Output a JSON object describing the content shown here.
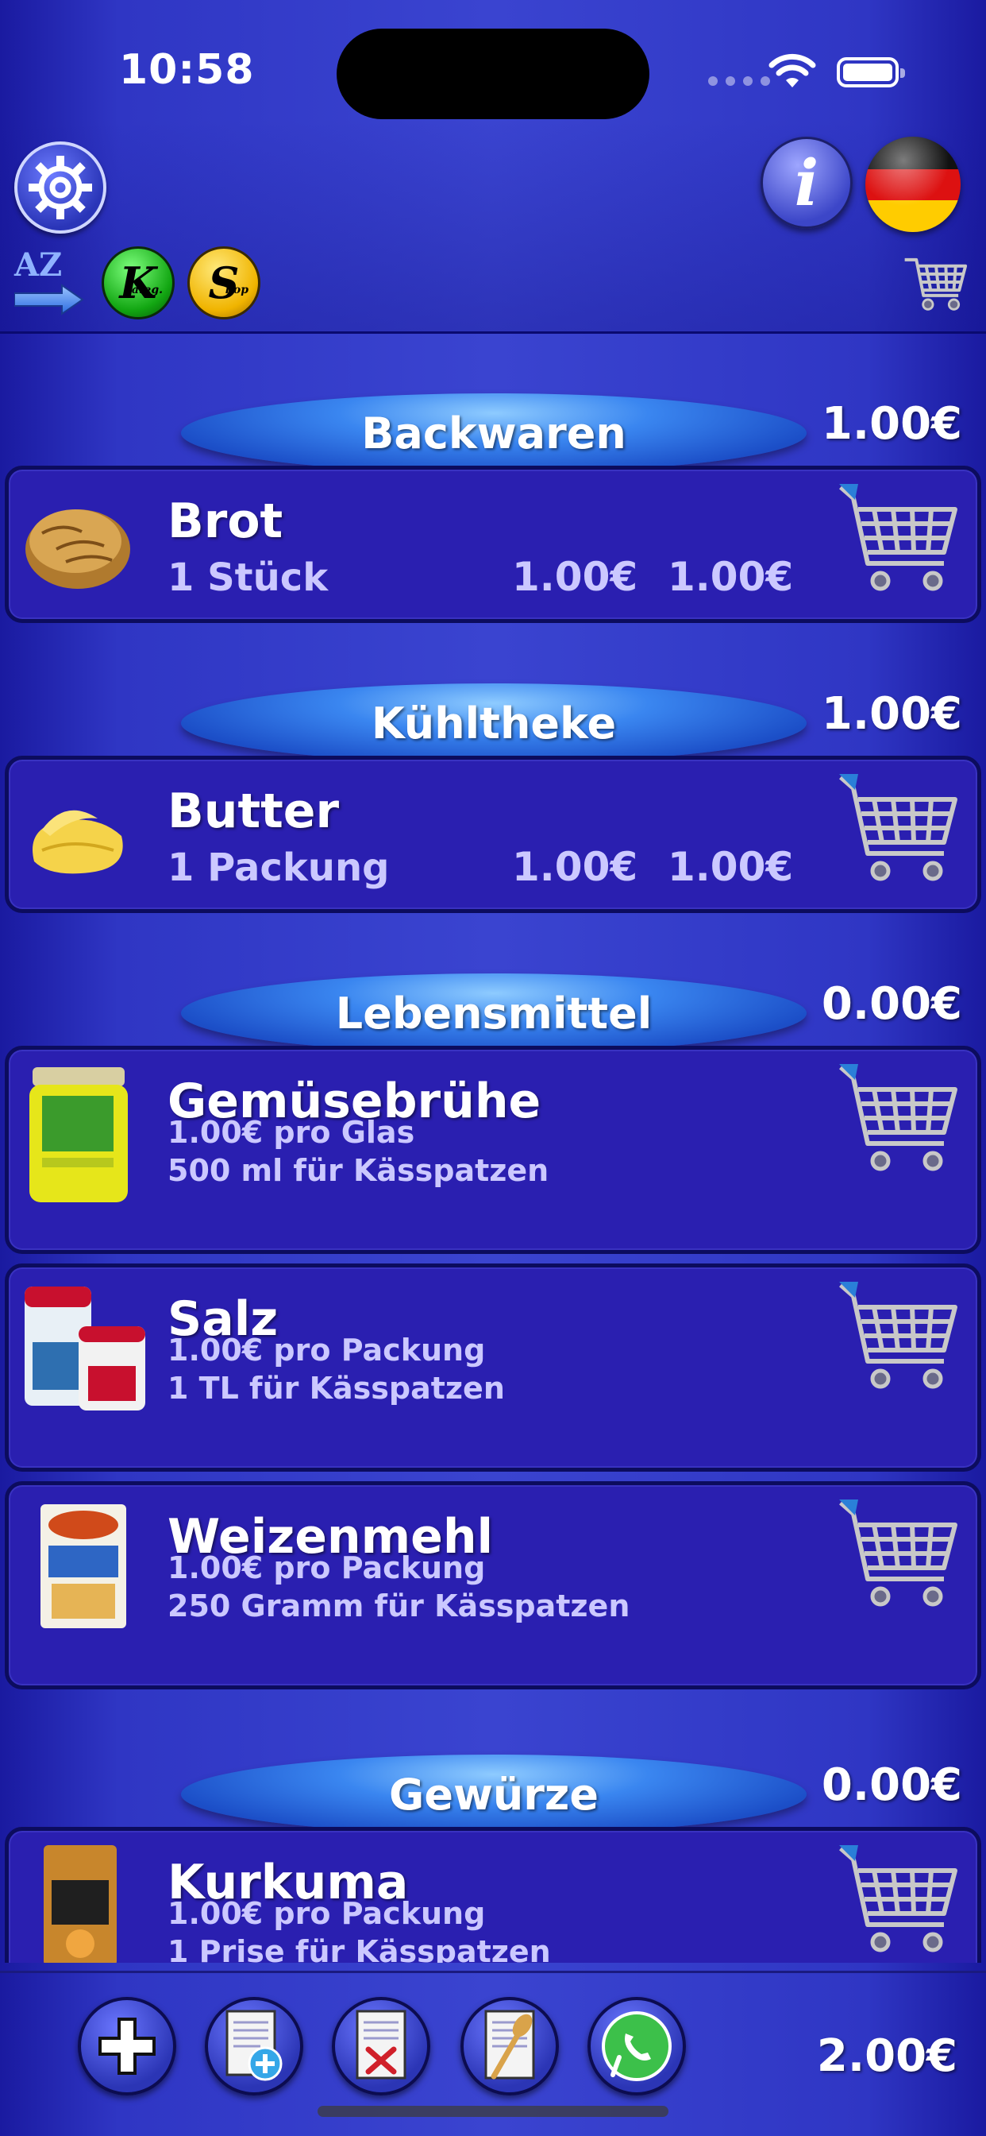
{
  "status_bar": {
    "time": "10:58"
  },
  "toolbar": {
    "settings_icon": "gear-icon",
    "info_label": "i",
    "language_flag": "germany-flag-icon",
    "sort_icon": "az-sort-icon",
    "sort_label": "AZ",
    "category_button": {
      "letter": "K",
      "suffix": "ateg."
    },
    "shop_button": {
      "letter": "S",
      "suffix": "hop"
    },
    "cart_icon": "shopping-cart-icon"
  },
  "categories": [
    {
      "name": "Backwaren",
      "total": "1.00€",
      "items": [
        {
          "name": "Brot",
          "quantity": "1 Stück",
          "unit_price": "1.00€",
          "line_total": "1.00€",
          "image": "bread-icon"
        }
      ]
    },
    {
      "name": "Kühltheke",
      "total": "1.00€",
      "items": [
        {
          "name": "Butter",
          "quantity": "1 Packung",
          "unit_price": "1.00€",
          "line_total": "1.00€",
          "image": "butter-icon"
        }
      ]
    },
    {
      "name": "Lebensmittel",
      "total": "0.00€",
      "items": [
        {
          "name": "Gemüsebrühe",
          "price_line": "1.00€ pro Glas",
          "recipe_line": "500 ml für Kässpatzen",
          "image": "broth-jar-icon"
        },
        {
          "name": "Salz",
          "price_line": "1.00€ pro Packung",
          "recipe_line": "1 TL für Kässpatzen",
          "image": "salt-icon"
        },
        {
          "name": "Weizenmehl",
          "price_line": "1.00€ pro Packung",
          "recipe_line": "250 Gramm für Kässpatzen",
          "image": "flour-icon"
        }
      ]
    },
    {
      "name": "Gewürze",
      "total": "0.00€",
      "items": [
        {
          "name": "Kurkuma",
          "price_line": "1.00€ pro Packung",
          "recipe_line": "1 Prise für Kässpatzen",
          "image": "turmeric-icon"
        }
      ]
    }
  ],
  "bottom_bar": {
    "buttons": [
      "add-icon",
      "new-list-icon",
      "delete-list-icon",
      "recipe-icon",
      "whatsapp-icon"
    ],
    "grand_total": "2.00€"
  },
  "colors": {
    "background": "#3a44d0",
    "item_bg": "#2a1fb0",
    "item_border": "#0c0c5e",
    "pill": "#3a86f0",
    "secondary_text": "#cbc8ff"
  }
}
